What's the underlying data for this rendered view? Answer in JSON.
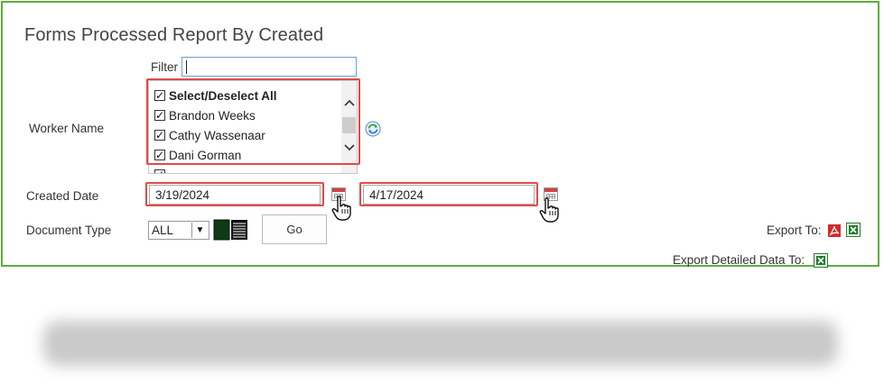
{
  "title": "Forms Processed Report By Created",
  "filter": {
    "label": "Filter",
    "value": ""
  },
  "worker_name": {
    "label": "Worker Name",
    "items": [
      {
        "label": "Select/Deselect All",
        "checked": true
      },
      {
        "label": "Brandon Weeks",
        "checked": true
      },
      {
        "label": "Cathy Wassenaar",
        "checked": true
      },
      {
        "label": "Dani Gorman",
        "checked": true
      }
    ],
    "refresh_icon": "refresh-icon"
  },
  "created_date": {
    "label": "Created Date",
    "from": "3/19/2024",
    "to": "4/17/2024",
    "calendar_icon": "calendar-icon"
  },
  "document_type": {
    "label": "Document Type",
    "selected": "ALL",
    "book_icon": "book-icon"
  },
  "go_button": "Go",
  "export": {
    "label": "Export To:",
    "detailed_label": "Export Detailed Data To:",
    "pdf_icon": "pdf-icon",
    "excel_icon": "excel-icon"
  },
  "colors": {
    "panel_border": "#5fad3c",
    "highlight": "#e24a4a",
    "filter_border": "#6e9fd4"
  }
}
